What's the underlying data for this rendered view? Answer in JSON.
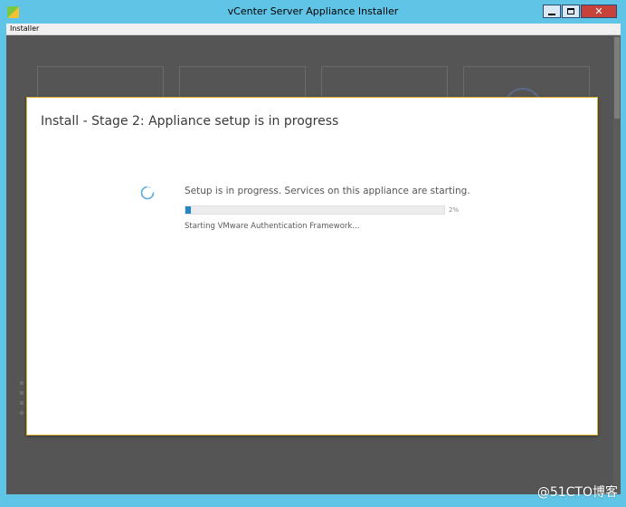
{
  "window": {
    "title": "vCenter Server Appliance Installer",
    "controls": {
      "minimize": "",
      "maximize": "",
      "close": "✕"
    }
  },
  "menu": {
    "items": [
      "Installer"
    ]
  },
  "dialog": {
    "title": "Install - Stage 2: Appliance setup is in progress",
    "status_text": "Setup is in progress. Services on this appliance are starting.",
    "progress": {
      "percent": 2,
      "label": "2%"
    },
    "detail_text": "Starting VMware Authentication Framework..."
  },
  "watermark": "@51CTO博客",
  "colors": {
    "titlebar": "#5fc4e6",
    "progress_fill": "#1f89c6",
    "dialog_border": "#e6b433",
    "close_button": "#c7423a"
  },
  "icons": {
    "app": "vcenter-installer-icon",
    "spinner": "loading-spinner-icon"
  }
}
